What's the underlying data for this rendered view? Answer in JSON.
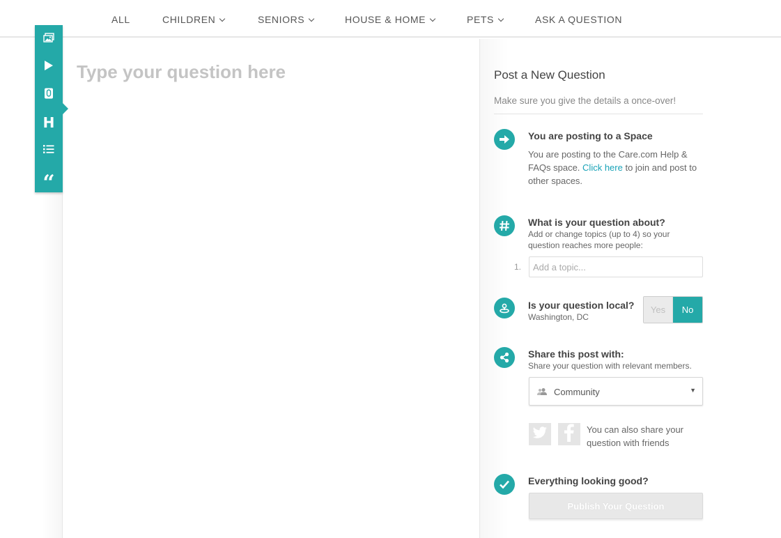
{
  "nav": {
    "items": [
      {
        "label": "ALL",
        "dropdown": false
      },
      {
        "label": "CHILDREN",
        "dropdown": true
      },
      {
        "label": "SENIORS",
        "dropdown": true
      },
      {
        "label": "HOUSE & HOME",
        "dropdown": true
      },
      {
        "label": "PETS",
        "dropdown": true
      },
      {
        "label": "ASK A QUESTION",
        "dropdown": false
      }
    ]
  },
  "toolbar": {
    "accent": "#24a9a8",
    "buttons": [
      {
        "icon": "image-icon"
      },
      {
        "icon": "play-video-icon"
      },
      {
        "icon": "attachment-icon"
      },
      {
        "icon": "heading-icon",
        "glyph": "H"
      },
      {
        "icon": "list-icon"
      },
      {
        "icon": "quote-icon",
        "glyph": "“"
      }
    ]
  },
  "editor": {
    "question_placeholder": "Type your question here"
  },
  "panel": {
    "title": "Post a New Question",
    "subtitle": "Make sure you give the details a once-over!",
    "space": {
      "title": "You are posting to a Space",
      "text_before": "You are posting to the Care.com Help & FAQs space.",
      "link": "Click here",
      "text_after": "to join and post to other spaces."
    },
    "topics": {
      "title": "What is your question about?",
      "text": "Add or change topics (up to 4) so your question reaches more people:",
      "number": "1.",
      "placeholder": "Add a topic..."
    },
    "local": {
      "title": "Is your question local?",
      "location": "Washington, DC",
      "yes_label": "Yes",
      "no_label": "No",
      "selected": "No"
    },
    "share": {
      "title": "Share this post with:",
      "text": "Share your question with relevant members.",
      "selected": "Community",
      "social_text": "You can also share your question with friends"
    },
    "final": {
      "title": "Everything looking good?",
      "publish_label": "Publish Your Question"
    }
  }
}
